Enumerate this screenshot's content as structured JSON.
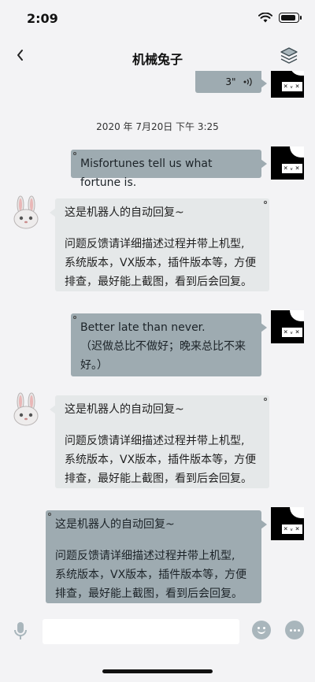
{
  "status_bar": {
    "time": "2:09"
  },
  "nav": {
    "title": "机械兔子"
  },
  "chat": {
    "voice_duration": "3\"",
    "timestamp": "2020 年 7月20日 下午 3:25",
    "messages": [
      {
        "side": "out",
        "text": "Misfortunes tell us what fortune is."
      },
      {
        "side": "in",
        "title": "这是机器人的自动回复~",
        "lines": [
          "问题反馈请详细描述过程并带上机型,",
          "系统版本，VX版本，插件版本等，方便",
          "排查，最好能上截图，看到后会回复。"
        ]
      },
      {
        "side": "out",
        "lines": [
          "Better late than never.",
          "（迟做总比不做好；晚来总比不来",
          "好。）"
        ]
      },
      {
        "side": "in",
        "title": "这是机器人的自动回复~",
        "lines": [
          "问题反馈请详细描述过程并带上机型,",
          "系统版本，VX版本，插件版本等，方便",
          "排查，最好能上截图，看到后会回复。"
        ]
      },
      {
        "side": "out",
        "title": "这是机器人的自动回复~",
        "lines": [
          "问题反馈请详细描述过程并带上机型,",
          "系统版本，VX版本，插件版本等，方便",
          "排查，最好能上截图，看到后会回复。"
        ]
      }
    ]
  },
  "input": {
    "placeholder": ""
  },
  "icons": {
    "back": "chevron-left-icon",
    "layers": "layers-icon",
    "voice": "voice-wave-icon",
    "mic": "microphone-icon",
    "emoji": "emoji-icon",
    "more": "more-icon"
  },
  "colors": {
    "outgoing_bubble": "#9eabb1",
    "incoming_bubble": "#e5e8e9",
    "background": "#f3f3f5",
    "accent_icon": "#a9b6bc"
  }
}
